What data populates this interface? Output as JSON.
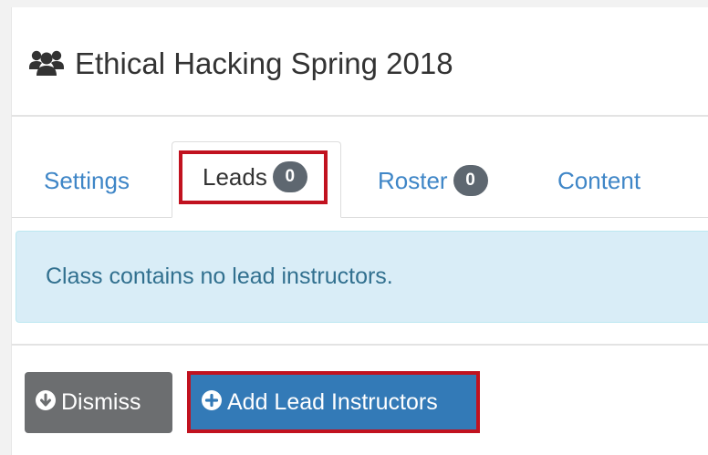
{
  "header": {
    "title": "Ethical Hacking Spring 2018",
    "icon": "users-icon"
  },
  "tabs": [
    {
      "label": "Settings"
    },
    {
      "label": "Leads",
      "badge": "0",
      "active": true
    },
    {
      "label": "Roster",
      "badge": "0"
    },
    {
      "label": "Content"
    }
  ],
  "alert": {
    "message": "Class contains no lead instructors."
  },
  "actions": {
    "dismiss_label": "Dismiss",
    "dismiss_icon": "arrow-circle-down-icon",
    "add_label": "Add Lead Instructors",
    "add_icon": "plus-circle-icon"
  },
  "colors": {
    "link": "#3f86c7",
    "highlight": "#c1121f",
    "alert_bg": "#d9edf7",
    "primary": "#337ab7",
    "secondary": "#6c6e70"
  }
}
